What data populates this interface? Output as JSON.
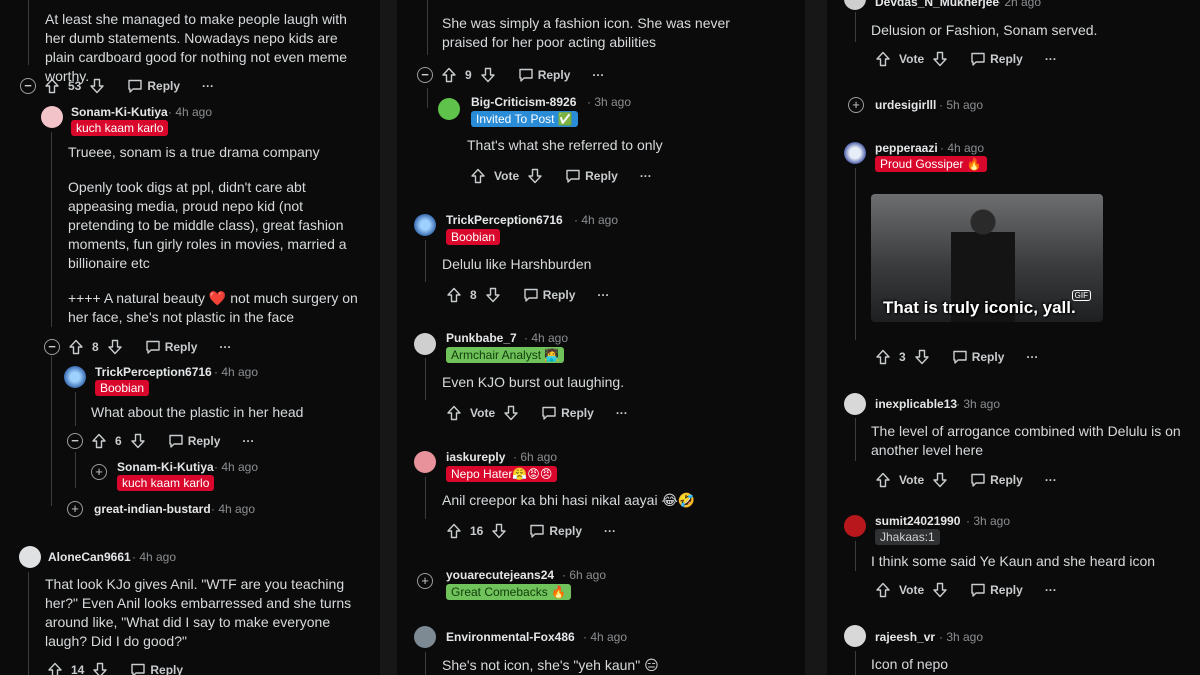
{
  "p1": {
    "c1": {
      "text": "At least she managed to make people laugh with her dumb statements. Nowadays nepo kids are plain cardboard good for nothing not even meme worthy.",
      "votes": "53",
      "reply": "Reply"
    },
    "c2": {
      "user": "Sonam-Ki-Kutiya",
      "time": "· 4h ago",
      "flair": "kuch kaam karlo",
      "t1": "Trueee, sonam is a true drama company",
      "t2": "Openly took digs at ppl, didn't care abt appeasing media, proud nepo kid (not pretending to be middle class), great fashion moments, fun girly roles in movies, married a billionaire etc",
      "t3": "++++ A natural beauty ❤️ not much surgery on her face, she's not plastic in the face",
      "votes": "8",
      "reply": "Reply"
    },
    "c3": {
      "user": "TrickPerception6716",
      "time": "· 4h ago",
      "flair": "Boobian",
      "text": "What about the plastic in her head",
      "votes": "6",
      "reply": "Reply"
    },
    "c4": {
      "user": "Sonam-Ki-Kutiya",
      "time": "· 4h ago",
      "flair": "kuch kaam karlo"
    },
    "c5": {
      "user": "great-indian-bustard",
      "time": "· 4h ago"
    },
    "c6": {
      "user": "AloneCan9661",
      "time": "· 4h ago",
      "text": "That look KJo gives Anil. \"WTF are you teaching her?\" Even Anil looks embarressed and she turns around like, \"What did I say to make everyone laugh? Did I do good?\"",
      "votes": "14",
      "reply": "Reply"
    }
  },
  "p2": {
    "c1": {
      "text": "She was simply a fashion icon. She was never praised for her poor acting abilities",
      "votes": "9",
      "reply": "Reply"
    },
    "c2": {
      "user": "Big-Criticism-8926",
      "time": "· 3h ago",
      "flair": "Invited To Post ✅",
      "text": "That's what she referred to only",
      "vote": "Vote",
      "reply": "Reply"
    },
    "c3": {
      "user": "TrickPerception6716",
      "time": "· 4h ago",
      "flair": "Boobian",
      "text": "Delulu like Harshburden",
      "votes": "8",
      "reply": "Reply"
    },
    "c4": {
      "user": "Punkbabe_7",
      "time": "· 4h ago",
      "flair": "Armchair Analyst 🧑‍💻",
      "text": "Even KJO burst out laughing.",
      "vote": "Vote",
      "reply": "Reply"
    },
    "c5": {
      "user": "iaskureply",
      "time": "· 6h ago",
      "flair": "Nepo Hater😤😡😠",
      "text": "Anil creepor ka bhi hasi nikal aayai 😂🤣",
      "votes": "16",
      "reply": "Reply"
    },
    "c6": {
      "user": "youarecutejeans24",
      "time": "· 6h ago",
      "flair": "Great Comebacks 🔥"
    },
    "c7": {
      "user": "Environmental-Fox486",
      "time": "· 4h ago",
      "text": "She's not icon, she's \"yeh kaun\" 😑"
    }
  },
  "p3": {
    "c1": {
      "user": "Devdas_N_Mukherjee",
      "time": "· 2h ago",
      "text": "Delusion or Fashion, Sonam served.",
      "vote": "Vote",
      "reply": "Reply"
    },
    "c2": {
      "user": "urdesigirlll",
      "time": "· 5h ago"
    },
    "c3": {
      "user": "pepperaazi",
      "time": "· 4h ago",
      "flair": "Proud Gossiper 🔥",
      "gif_caption": "That is truly iconic, yall.",
      "gif_tag": "GIF",
      "votes": "3",
      "reply": "Reply"
    },
    "c4": {
      "user": "inexplicable13",
      "time": "· 3h ago",
      "text": "The level of arrogance combined with Delulu is on another level here",
      "vote": "Vote",
      "reply": "Reply"
    },
    "c5": {
      "user": "sumit24021990",
      "time": "· 3h ago",
      "flair": "Jhakaas:1",
      "text": "I think some said Ye Kaun and she heard icon",
      "vote": "Vote",
      "reply": "Reply"
    },
    "c6": {
      "user": "rajeesh_vr",
      "time": "· 3h ago",
      "text": "Icon of nepo"
    }
  },
  "icons": {
    "upvote": "arrow-up-icon",
    "downvote": "arrow-down-icon",
    "reply": "speech-bubble-icon",
    "more": "ellipsis-icon",
    "collapse": "minus-circle-icon",
    "expand": "plus-circle-icon"
  },
  "colors": {
    "red_flair": "#d8072b",
    "blue_flair": "#2a8bd6",
    "green_flair": "#6fc35a",
    "background": "#0b0b0b"
  }
}
